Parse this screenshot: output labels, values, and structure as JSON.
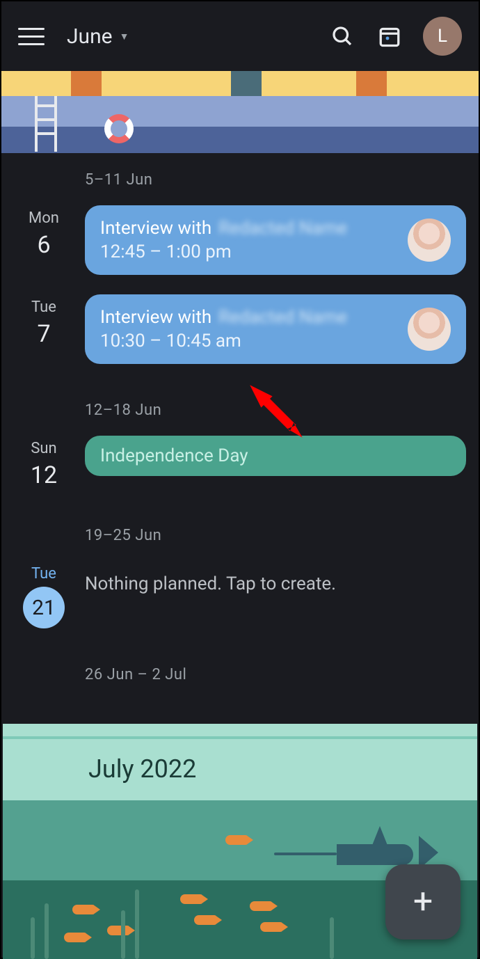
{
  "header": {
    "month": "June",
    "avatar_letter": "L"
  },
  "weeks": [
    {
      "label": "5–11 Jun"
    },
    {
      "label": "12–18 Jun"
    },
    {
      "label": "19–25 Jun"
    },
    {
      "label": "26 Jun – 2 Jul"
    }
  ],
  "days": {
    "mon6": {
      "dow": "Mon",
      "num": "6"
    },
    "tue7": {
      "dow": "Tue",
      "num": "7"
    },
    "sun12": {
      "dow": "Sun",
      "num": "12"
    },
    "tue21": {
      "dow": "Tue",
      "num": "21"
    }
  },
  "events": {
    "e1": {
      "title_prefix": "Interview with",
      "title_name": "Redacted Name",
      "time": "12:45 – 1:00 pm"
    },
    "e2": {
      "title_prefix": "Interview with",
      "title_name": "Redacted Name",
      "time": "10:30 – 10:45 am"
    },
    "e3": {
      "title": "Independence Day"
    }
  },
  "empty_text": "Nothing planned. Tap to create.",
  "next_month": "July 2022",
  "fab_label": "+",
  "colors": {
    "event_blue": "#6aa5df",
    "event_teal": "#4aa38d",
    "today_highlight": "#92c6f5",
    "annotation_arrow": "#ff0000"
  }
}
